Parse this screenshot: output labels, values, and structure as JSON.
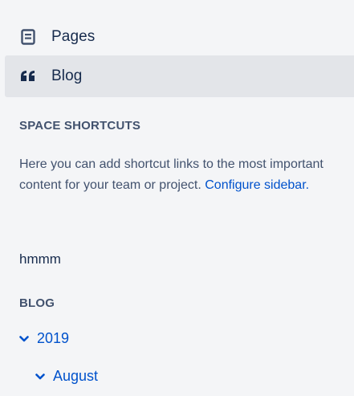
{
  "nav": {
    "pages_label": "Pages",
    "blog_label": "Blog",
    "selected": "Blog"
  },
  "shortcuts": {
    "heading": "SPACE SHORTCUTS",
    "description": "Here you can add shortcut links to the most important content for your team or project.",
    "configure_link": "Configure sidebar.",
    "items": [
      {
        "label": "hmmm"
      }
    ]
  },
  "blog": {
    "heading": "BLOG",
    "tree": {
      "year": "2019",
      "month": "August"
    }
  },
  "colors": {
    "background": "#f4f5f7",
    "selected_bg": "#e3e5e9",
    "link": "#0052cc",
    "text": "#172b4d",
    "muted": "#42526e"
  },
  "icons": {
    "pages": "page-icon",
    "blog": "quote-icon",
    "expand": "chevron-down-icon"
  }
}
